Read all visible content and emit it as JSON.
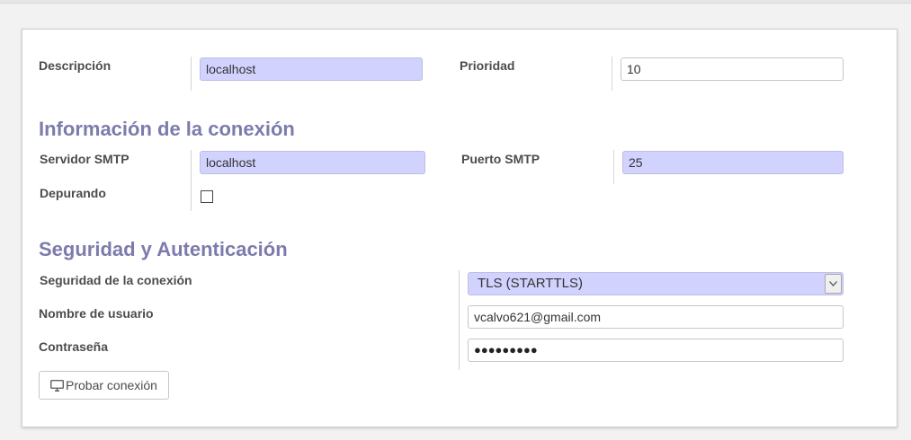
{
  "form": {
    "descripcion": {
      "label": "Descripción",
      "value": "localhost"
    },
    "prioridad": {
      "label": "Prioridad",
      "value": "10"
    },
    "section_connection": "Información de la conexión",
    "servidor": {
      "label": "Servidor SMTP",
      "value": "localhost"
    },
    "puerto": {
      "label": "Puerto SMTP",
      "value": "25"
    },
    "depurando": {
      "label": "Depurando",
      "checked": false
    },
    "section_security": "Seguridad y Autenticación",
    "seguridad": {
      "label": "Seguridad de la conexión",
      "value": "TLS (STARTTLS)"
    },
    "usuario": {
      "label": "Nombre de usuario",
      "value": "vcalvo621@gmail.com"
    },
    "contrasena": {
      "label": "Contraseña",
      "value": "●●●●●●●●●"
    },
    "test_button": {
      "label": "Probar conexión",
      "icon": "monitor-icon"
    }
  },
  "colors": {
    "required_bg": "#d2d2ff",
    "heading": "#7c7bad"
  }
}
